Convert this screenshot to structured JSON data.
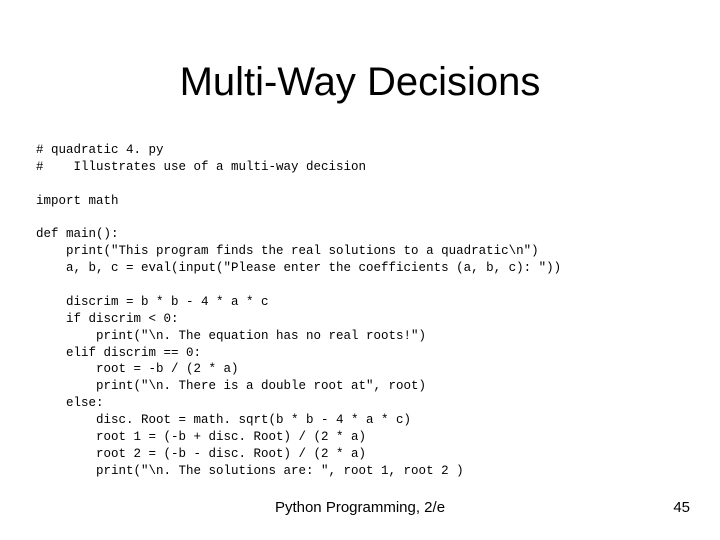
{
  "slide": {
    "title": "Multi-Way Decisions",
    "code": "# quadratic 4. py\n#    Illustrates use of a multi-way decision\n\nimport math\n\ndef main():\n    print(\"This program finds the real solutions to a quadratic\\n\")\n    a, b, c = eval(input(\"Please enter the coefficients (a, b, c): \"))\n\n    discrim = b * b - 4 * a * c\n    if discrim < 0:\n        print(\"\\n. The equation has no real roots!\")\n    elif discrim == 0:\n        root = -b / (2 * a)\n        print(\"\\n. There is a double root at\", root)\n    else:\n        disc. Root = math. sqrt(b * b - 4 * a * c)\n        root 1 = (-b + disc. Root) / (2 * a)\n        root 2 = (-b - disc. Root) / (2 * a)\n        print(\"\\n. The solutions are: \", root 1, root 2 )",
    "footer_center": "Python Programming, 2/e",
    "page_number": "45"
  }
}
